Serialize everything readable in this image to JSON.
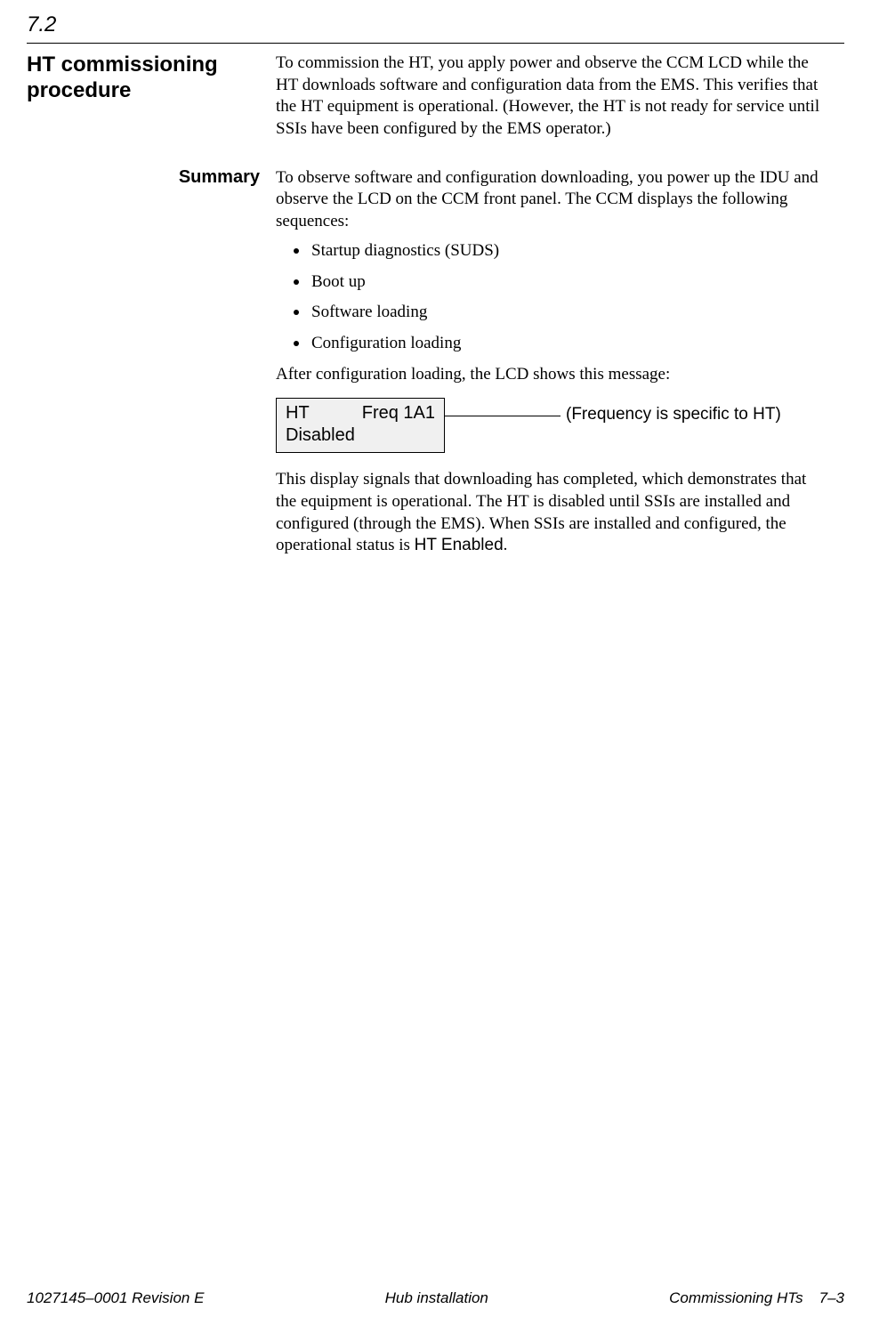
{
  "section_number": "7.2",
  "heading_main": "HT commissioning procedure",
  "intro_para": "To commission the HT, you apply power and observe the CCM LCD while the HT downloads software and configuration data from the EMS. This verifies that the HT equipment is operational. (However, the HT is not ready for service until SSIs have been configured by the EMS operator.)",
  "summary_label": "Summary",
  "summary_intro": "To observe software and configuration downloading, you power up the IDU and observe the LCD on the CCM front panel. The CCM displays the following sequences:",
  "sequences": [
    "Startup diagnostics (SUDS)",
    "Boot up",
    "Software loading",
    "Configuration loading"
  ],
  "after_seq": "After configuration loading, the LCD shows this message:",
  "lcd": {
    "line1_left": "HT",
    "line1_right": "Freq 1A1",
    "line2": "Disabled"
  },
  "lcd_annotation": "(Frequency is specific to HT)",
  "closing_para_1": "This display signals that downloading has completed, which demonstrates that the equipment is operational. The HT is disabled until SSIs are installed and configured (through the EMS). When SSIs are installed and configured, the operational status is ",
  "closing_status": "HT Enabled",
  "closing_period": ".",
  "footer": {
    "left": "1027145–0001  Revision E",
    "center": "Hub installation",
    "right_title": "Commissioning HTs",
    "right_page": "7–3"
  }
}
